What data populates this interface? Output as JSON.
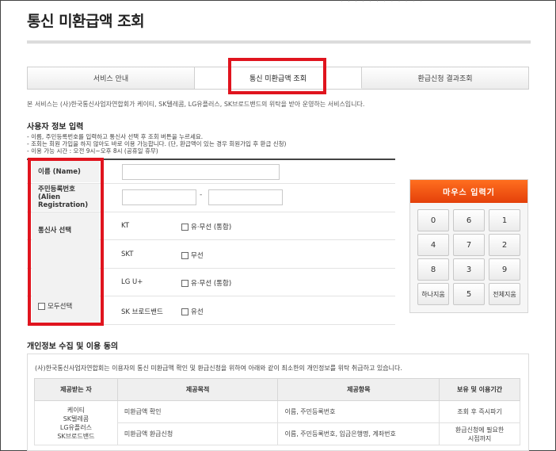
{
  "page": {
    "title": "통신 미환급액 조회",
    "top_fragment": "· · ·   · · ·   · · ·   · · ·"
  },
  "tabs": [
    {
      "label": "서비스 안내"
    },
    {
      "label": "통신 미환급액 조회"
    },
    {
      "label": "환급신청 결과조회"
    }
  ],
  "intro": "본 서비스는 (사)한국통신사업자연합회가 케이티, SK텔레콤, LG유플러스, SK브로드밴드의 위탁을 받아 운영하는 서비스입니다.",
  "user_section": {
    "title": "사용자 정보 입력",
    "notes": [
      "- 이름, 주민등록번호를 입력하고 통신사 선택 후 조회 버튼을 누르세요.",
      "- 조회는 회원 가입을 하지 않아도 바로 이용 가능합니다. (단, 환급액이 있는 경우 회원가입 후 환급 신청)",
      "- 이용 가능 시간 : 오전 9시~오후 8시 (공휴일 휴무)"
    ]
  },
  "form": {
    "name_label": "이름 (Name)",
    "rrn_label_1": "주민등록번호",
    "rrn_label_2": "(Alien Registration)",
    "rrn_separator": "-",
    "carrier_label": "통신사 선택",
    "select_all": "모두선택",
    "carriers": [
      {
        "name": "KT",
        "option": "유·무선 (통합)"
      },
      {
        "name": "SKT",
        "option": "무선"
      },
      {
        "name": "LG U+",
        "option": "유·무선 (통합)"
      },
      {
        "name": "SK 브로드밴드",
        "option": "유선"
      }
    ]
  },
  "keypad": {
    "title": "마우스 입력기",
    "keys": [
      "0",
      "6",
      "1",
      "4",
      "7",
      "2",
      "8",
      "3",
      "9",
      "하나지움",
      "5",
      "전체지움"
    ]
  },
  "consent": {
    "title": "개인정보 수집 및 이용 동의",
    "text": "(사)한국통신사업자연합회는 이용자의 통신 미환급액 확인 및 환급신청을 위하여 아래와 같이 최소한의 개인정보를 위탁 취급하고 있습니다.",
    "headers": [
      "제공받는 자",
      "제공목적",
      "제공항목",
      "보유 및 이용기간"
    ],
    "recipients": [
      "케이티",
      "SK텔레콤",
      "LG유플러스",
      "SK브로드밴드"
    ],
    "rows": [
      {
        "purpose": "미환급액 확인",
        "items": "이름, 주민등록번호",
        "period": "조회 후 즉시파기"
      },
      {
        "purpose": "미환급액 환급신청",
        "items": "이름, 주민등록번호, 입금은행명, 계좌번호",
        "period_1": "환급신청에 필요한",
        "period_2": "시점까지"
      }
    ]
  },
  "colors": {
    "highlight": "#e0141e",
    "keypad_header": "#e4400a"
  }
}
